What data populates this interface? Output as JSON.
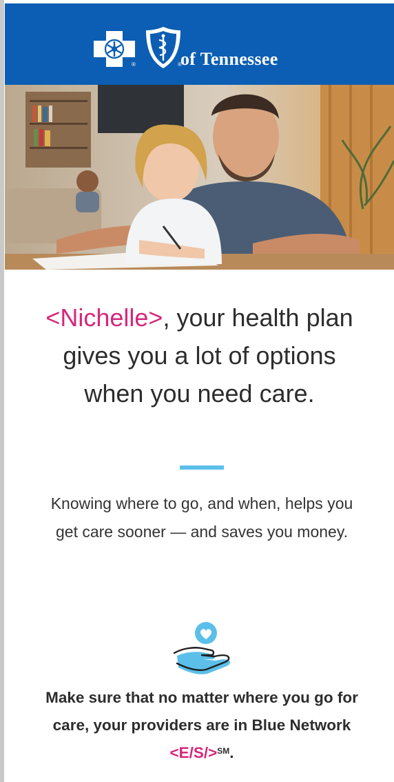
{
  "header": {
    "brand_suffix": "of Tennessee",
    "registered_mark": "®"
  },
  "hero": {
    "icon": "photo-father-daughter-drawing"
  },
  "headline": {
    "name": "<Nichelle>",
    "text": ", your health plan gives you a lot of options when you need care."
  },
  "intro": {
    "text": "Knowing where to go, and when, helps you get care sooner — and saves you money."
  },
  "care_section": {
    "icon": "heart-hand-icon",
    "text": "Make sure that no matter where you go for care, your providers are in Blue Network ",
    "network": "<E/S/>",
    "mark": "SM",
    "end": "."
  },
  "colors": {
    "brand_blue": "#0b5eb3",
    "accent_pink": "#d6277a",
    "divider_blue": "#5bbfea"
  }
}
